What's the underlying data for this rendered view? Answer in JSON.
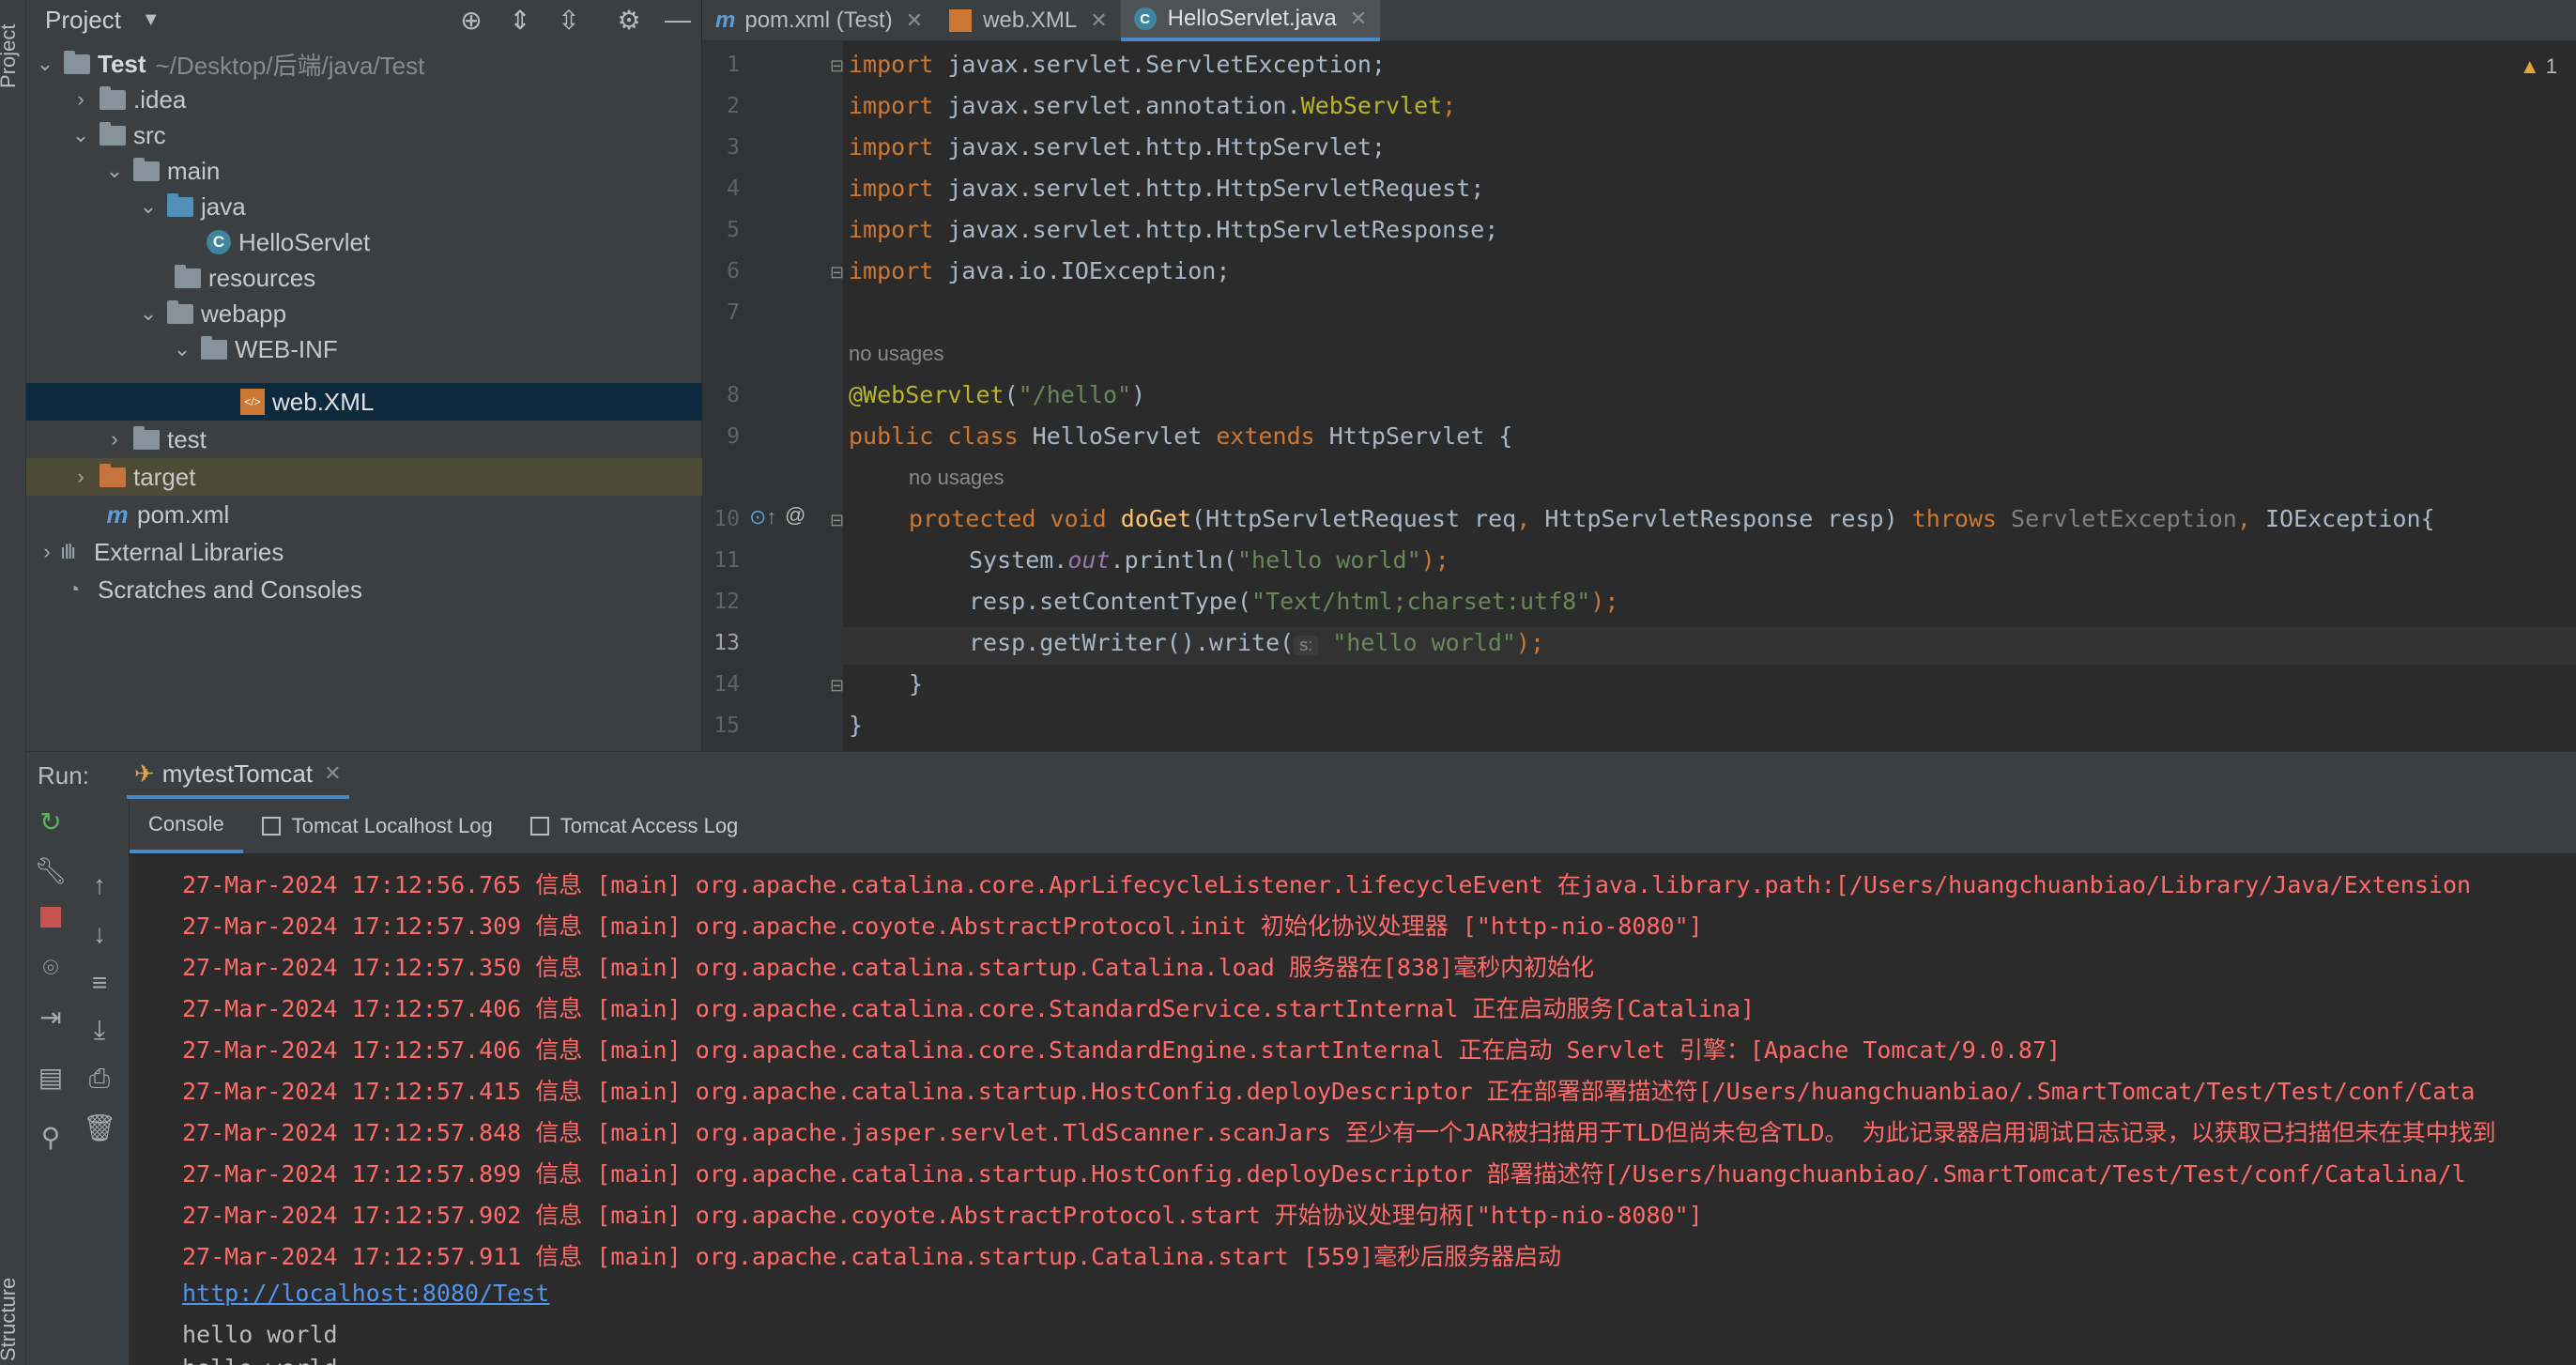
{
  "sidebar_strip": {
    "project_label": "Project",
    "structure_label": "Structure"
  },
  "project_panel": {
    "title": "Project",
    "tree": [
      {
        "label": "Test",
        "path": "~/Desktop/后端/java/Test"
      },
      {
        "label": ".idea"
      },
      {
        "label": "src"
      },
      {
        "label": "main"
      },
      {
        "label": "java"
      },
      {
        "label": "HelloServlet"
      },
      {
        "label": "resources"
      },
      {
        "label": "webapp"
      },
      {
        "label": "WEB-INF"
      },
      {
        "label": "web.XML"
      },
      {
        "label": "test"
      },
      {
        "label": "target"
      },
      {
        "label": "pom.xml"
      },
      {
        "label": "External Libraries"
      },
      {
        "label": "Scratches and Consoles"
      }
    ]
  },
  "editor": {
    "tabs": [
      {
        "label": "pom.xml (Test)"
      },
      {
        "label": "web.XML"
      },
      {
        "label": "HelloServlet.java"
      }
    ],
    "warning_count": "1",
    "hint_no_usages": "no usages",
    "line_numbers": [
      "1",
      "2",
      "3",
      "4",
      "5",
      "6",
      "7",
      "8",
      "9",
      "10",
      "11",
      "12",
      "13",
      "14",
      "15"
    ],
    "code": {
      "l1_kw": "import",
      "l1_rest": " javax.servlet.ServletException;",
      "l2_kw": "import",
      "l2_a": " javax.servlet.annotation.",
      "l2_ann": "WebServlet",
      "l2_b": ";",
      "l3_kw": "import",
      "l3_rest": " javax.servlet.http.HttpServlet;",
      "l4_kw": "import",
      "l4_rest": " javax.servlet.http.HttpServletRequest;",
      "l5_kw": "import",
      "l5_rest": " javax.servlet.http.HttpServletResponse;",
      "l6_kw": "import",
      "l6_rest": " java.io.IOException;",
      "l8_ann": "@WebServlet",
      "l8_a": "(",
      "l8_str": "\"/hello\"",
      "l8_b": ")",
      "l9_kw1": "public class",
      "l9_a": " HelloServlet ",
      "l9_kw2": "extends",
      "l9_b": " HttpServlet {",
      "l10_kw": "protected void",
      "l10_fn": " doGet",
      "l10_a": "(HttpServletRequest req",
      "l10_c1": ",",
      "l10_b": " HttpServletResponse resp) ",
      "l10_kw2": "throws",
      "l10_g": " ServletException",
      "l10_c2": ",",
      "l10_c": " IOException{",
      "l11_a": "System.",
      "l11_it": "out",
      "l11_b": ".println(",
      "l11_str": "\"hello world\"",
      "l11_c": ");",
      "l12_a": "resp.setContentType(",
      "l12_str": "\"Text/html;charset:utf8\"",
      "l12_b": ");",
      "l13_a": "resp.getWriter().write(",
      "l13_param": "s:",
      "l13_str": " \"hello world\"",
      "l13_b": ");",
      "l14": "}",
      "l15": "}"
    }
  },
  "run_panel": {
    "run_label": "Run:",
    "config_name": "mytestTomcat",
    "subtabs": [
      "Console",
      "Tomcat Localhost Log",
      "Tomcat Access Log"
    ],
    "log_lines": [
      "27-Mar-2024 17:12:56.765 信息 [main] org.apache.catalina.core.AprLifecycleListener.lifecycleEvent 在java.library.path:[/Users/huangchuanbiao/Library/Java/Extension",
      "27-Mar-2024 17:12:57.309 信息 [main] org.apache.coyote.AbstractProtocol.init 初始化协议处理器 [\"http-nio-8080\"]",
      "27-Mar-2024 17:12:57.350 信息 [main] org.apache.catalina.startup.Catalina.load 服务器在[838]毫秒内初始化",
      "27-Mar-2024 17:12:57.406 信息 [main] org.apache.catalina.core.StandardService.startInternal 正在启动服务[Catalina]",
      "27-Mar-2024 17:12:57.406 信息 [main] org.apache.catalina.core.StandardEngine.startInternal 正在启动 Servlet 引擎：[Apache Tomcat/9.0.87]",
      "27-Mar-2024 17:12:57.415 信息 [main] org.apache.catalina.startup.HostConfig.deployDescriptor 正在部署部署描述符[/Users/huangchuanbiao/.SmartTomcat/Test/Test/conf/Cata",
      "27-Mar-2024 17:12:57.848 信息 [main] org.apache.jasper.servlet.TldScanner.scanJars 至少有一个JAR被扫描用于TLD但尚未包含TLD。 为此记录器启用调试日志记录，以获取已扫描但未在其中找到",
      "27-Mar-2024 17:12:57.899 信息 [main] org.apache.catalina.startup.HostConfig.deployDescriptor 部署描述符[/Users/huangchuanbiao/.SmartTomcat/Test/Test/conf/Catalina/l",
      "27-Mar-2024 17:12:57.902 信息 [main] org.apache.coyote.AbstractProtocol.start 开始协议处理句柄[\"http-nio-8080\"]",
      "27-Mar-2024 17:12:57.911 信息 [main] org.apache.catalina.startup.Catalina.start [559]毫秒后服务器启动"
    ],
    "link": "http://localhost:8080/Test",
    "output_lines": [
      "hello world",
      "hello world"
    ]
  },
  "colors": {
    "keyword": "#cc7832",
    "annotation": "#bbb529",
    "string": "#6a8759",
    "log_red": "#ff6b68",
    "selection": "#0d293e",
    "accent": "#4a88c7"
  }
}
